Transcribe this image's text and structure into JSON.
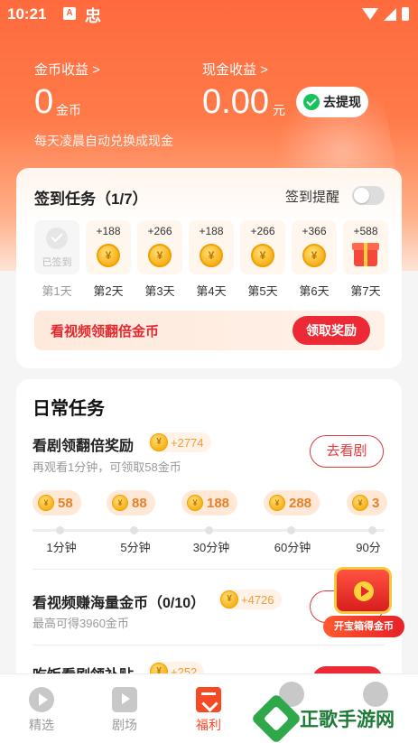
{
  "status_bar": {
    "time": "10:21",
    "notif_icon_1": "A",
    "notif_icon_2": "忠"
  },
  "earnings": {
    "coin_label": "金币收益 >",
    "coin_value": "0",
    "coin_unit": "金币",
    "cash_label": "现金收益 >",
    "cash_value": "0.00",
    "cash_unit": "元",
    "withdraw_label": "去提现",
    "note": "每天凌晨自动兑换成现金"
  },
  "signin": {
    "title": "签到任务（1/7）",
    "remind_label": "签到提醒",
    "remind_on": false,
    "days": [
      {
        "name": "第1天",
        "amount": "",
        "status": "已签到",
        "icon": "check-icon"
      },
      {
        "name": "第2天",
        "amount": "+188",
        "icon": "coin-icon"
      },
      {
        "name": "第3天",
        "amount": "+266",
        "icon": "coin-icon"
      },
      {
        "name": "第4天",
        "amount": "+188",
        "icon": "coin-icon"
      },
      {
        "name": "第5天",
        "amount": "+266",
        "icon": "coin-icon"
      },
      {
        "name": "第6天",
        "amount": "+366",
        "icon": "coin-icon"
      },
      {
        "name": "第7天",
        "amount": "+588",
        "icon": "gift-icon"
      }
    ],
    "coin_symbol": "¥",
    "bonus_text": "看视频领翻倍金币",
    "bonus_button": "领取奖励"
  },
  "daily": {
    "title": "日常任务",
    "task1": {
      "title": "看剧领翻倍奖励",
      "reward": "+2774",
      "sub": "再观看1分钟，可领取58金币",
      "button": "去看剧",
      "milestones": [
        {
          "coins": "58",
          "time": "1分钟"
        },
        {
          "coins": "88",
          "time": "5分钟"
        },
        {
          "coins": "188",
          "time": "30分钟"
        },
        {
          "coins": "288",
          "time": "60分钟"
        },
        {
          "coins": "3",
          "time": "90分"
        }
      ]
    },
    "task2": {
      "title": "看视频赚海量金币（0/10）",
      "reward": "+4726",
      "sub": "最高可得3960金币",
      "button": "去"
    },
    "task3": {
      "title": "吃饭看剧领补贴",
      "reward": "+252"
    }
  },
  "treasure": {
    "label": "开宝箱得金币"
  },
  "nav": [
    {
      "label": "精选",
      "icon": "play-circle-icon",
      "active": false
    },
    {
      "label": "剧场",
      "icon": "tv-icon",
      "active": false
    },
    {
      "label": "福利",
      "icon": "gift-bag-icon",
      "active": true
    },
    {
      "label": "",
      "icon": "cloud-icon",
      "active": false
    },
    {
      "label": "",
      "icon": "profile-icon",
      "active": false
    }
  ],
  "watermark": {
    "text": "正歌手游网"
  },
  "colors": {
    "accent": "#ec2a35",
    "hero": "#ff6a3d",
    "coin": "#f7b21b",
    "active_tab": "#f5482a"
  }
}
